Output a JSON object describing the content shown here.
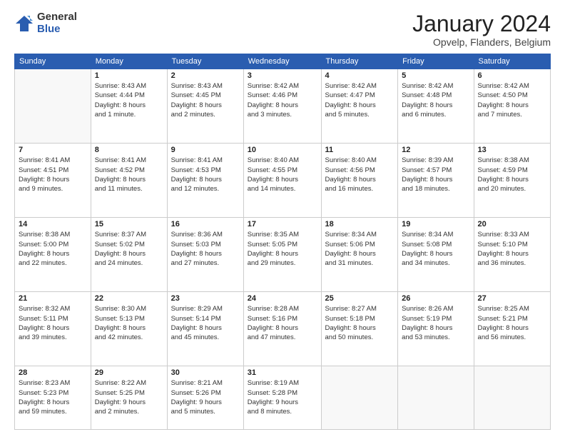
{
  "logo": {
    "general": "General",
    "blue": "Blue"
  },
  "header": {
    "month": "January 2024",
    "location": "Opvelp, Flanders, Belgium"
  },
  "weekdays": [
    "Sunday",
    "Monday",
    "Tuesday",
    "Wednesday",
    "Thursday",
    "Friday",
    "Saturday"
  ],
  "weeks": [
    [
      {
        "day": "",
        "info": ""
      },
      {
        "day": "1",
        "info": "Sunrise: 8:43 AM\nSunset: 4:44 PM\nDaylight: 8 hours\nand 1 minute."
      },
      {
        "day": "2",
        "info": "Sunrise: 8:43 AM\nSunset: 4:45 PM\nDaylight: 8 hours\nand 2 minutes."
      },
      {
        "day": "3",
        "info": "Sunrise: 8:42 AM\nSunset: 4:46 PM\nDaylight: 8 hours\nand 3 minutes."
      },
      {
        "day": "4",
        "info": "Sunrise: 8:42 AM\nSunset: 4:47 PM\nDaylight: 8 hours\nand 5 minutes."
      },
      {
        "day": "5",
        "info": "Sunrise: 8:42 AM\nSunset: 4:48 PM\nDaylight: 8 hours\nand 6 minutes."
      },
      {
        "day": "6",
        "info": "Sunrise: 8:42 AM\nSunset: 4:50 PM\nDaylight: 8 hours\nand 7 minutes."
      }
    ],
    [
      {
        "day": "7",
        "info": "Sunrise: 8:41 AM\nSunset: 4:51 PM\nDaylight: 8 hours\nand 9 minutes."
      },
      {
        "day": "8",
        "info": "Sunrise: 8:41 AM\nSunset: 4:52 PM\nDaylight: 8 hours\nand 11 minutes."
      },
      {
        "day": "9",
        "info": "Sunrise: 8:41 AM\nSunset: 4:53 PM\nDaylight: 8 hours\nand 12 minutes."
      },
      {
        "day": "10",
        "info": "Sunrise: 8:40 AM\nSunset: 4:55 PM\nDaylight: 8 hours\nand 14 minutes."
      },
      {
        "day": "11",
        "info": "Sunrise: 8:40 AM\nSunset: 4:56 PM\nDaylight: 8 hours\nand 16 minutes."
      },
      {
        "day": "12",
        "info": "Sunrise: 8:39 AM\nSunset: 4:57 PM\nDaylight: 8 hours\nand 18 minutes."
      },
      {
        "day": "13",
        "info": "Sunrise: 8:38 AM\nSunset: 4:59 PM\nDaylight: 8 hours\nand 20 minutes."
      }
    ],
    [
      {
        "day": "14",
        "info": "Sunrise: 8:38 AM\nSunset: 5:00 PM\nDaylight: 8 hours\nand 22 minutes."
      },
      {
        "day": "15",
        "info": "Sunrise: 8:37 AM\nSunset: 5:02 PM\nDaylight: 8 hours\nand 24 minutes."
      },
      {
        "day": "16",
        "info": "Sunrise: 8:36 AM\nSunset: 5:03 PM\nDaylight: 8 hours\nand 27 minutes."
      },
      {
        "day": "17",
        "info": "Sunrise: 8:35 AM\nSunset: 5:05 PM\nDaylight: 8 hours\nand 29 minutes."
      },
      {
        "day": "18",
        "info": "Sunrise: 8:34 AM\nSunset: 5:06 PM\nDaylight: 8 hours\nand 31 minutes."
      },
      {
        "day": "19",
        "info": "Sunrise: 8:34 AM\nSunset: 5:08 PM\nDaylight: 8 hours\nand 34 minutes."
      },
      {
        "day": "20",
        "info": "Sunrise: 8:33 AM\nSunset: 5:10 PM\nDaylight: 8 hours\nand 36 minutes."
      }
    ],
    [
      {
        "day": "21",
        "info": "Sunrise: 8:32 AM\nSunset: 5:11 PM\nDaylight: 8 hours\nand 39 minutes."
      },
      {
        "day": "22",
        "info": "Sunrise: 8:30 AM\nSunset: 5:13 PM\nDaylight: 8 hours\nand 42 minutes."
      },
      {
        "day": "23",
        "info": "Sunrise: 8:29 AM\nSunset: 5:14 PM\nDaylight: 8 hours\nand 45 minutes."
      },
      {
        "day": "24",
        "info": "Sunrise: 8:28 AM\nSunset: 5:16 PM\nDaylight: 8 hours\nand 47 minutes."
      },
      {
        "day": "25",
        "info": "Sunrise: 8:27 AM\nSunset: 5:18 PM\nDaylight: 8 hours\nand 50 minutes."
      },
      {
        "day": "26",
        "info": "Sunrise: 8:26 AM\nSunset: 5:19 PM\nDaylight: 8 hours\nand 53 minutes."
      },
      {
        "day": "27",
        "info": "Sunrise: 8:25 AM\nSunset: 5:21 PM\nDaylight: 8 hours\nand 56 minutes."
      }
    ],
    [
      {
        "day": "28",
        "info": "Sunrise: 8:23 AM\nSunset: 5:23 PM\nDaylight: 8 hours\nand 59 minutes."
      },
      {
        "day": "29",
        "info": "Sunrise: 8:22 AM\nSunset: 5:25 PM\nDaylight: 9 hours\nand 2 minutes."
      },
      {
        "day": "30",
        "info": "Sunrise: 8:21 AM\nSunset: 5:26 PM\nDaylight: 9 hours\nand 5 minutes."
      },
      {
        "day": "31",
        "info": "Sunrise: 8:19 AM\nSunset: 5:28 PM\nDaylight: 9 hours\nand 8 minutes."
      },
      {
        "day": "",
        "info": ""
      },
      {
        "day": "",
        "info": ""
      },
      {
        "day": "",
        "info": ""
      }
    ]
  ]
}
